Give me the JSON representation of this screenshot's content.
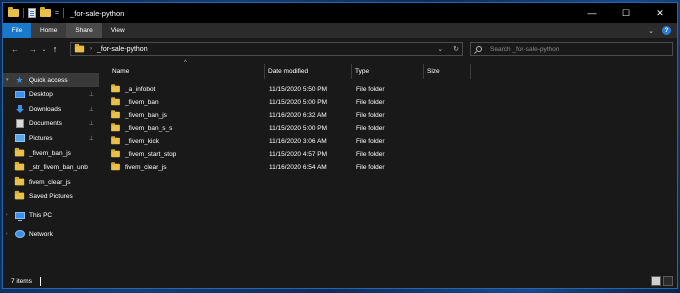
{
  "window": {
    "title": "_for-sale-python",
    "qat_arrow": "=",
    "controls": {
      "minimize": "—",
      "maximize": "☐",
      "close": "✕"
    }
  },
  "ribbon": {
    "tabs": [
      "File",
      "Home",
      "Share",
      "View"
    ],
    "expand_chevron": "⌄",
    "help": "?"
  },
  "nav": {
    "back": "←",
    "forward": "→",
    "recent": "⌄",
    "up": "↑",
    "address_chevron": "›",
    "address_path": "_for-sale-python",
    "address_dropdown": "⌄",
    "refresh": "↻",
    "search_placeholder": "Search _for-sale-python"
  },
  "sidebar": {
    "items": [
      {
        "label": "Quick access",
        "icon": "star-icon"
      },
      {
        "label": "Desktop",
        "icon": "desktop-icon",
        "pinned": true
      },
      {
        "label": "Downloads",
        "icon": "download-icon",
        "pinned": true
      },
      {
        "label": "Documents",
        "icon": "documents-icon",
        "pinned": true
      },
      {
        "label": "Pictures",
        "icon": "pictures-icon",
        "pinned": true
      },
      {
        "label": "_fivem_ban_js",
        "icon": "folder-icon"
      },
      {
        "label": "_str_fivem_ban_unb",
        "icon": "folder-icon"
      },
      {
        "label": "fivem_clear_js",
        "icon": "folder-icon"
      },
      {
        "label": "Saved Pictures",
        "icon": "folder-icon"
      },
      {
        "label": "This PC",
        "icon": "computer-icon"
      },
      {
        "label": "Network",
        "icon": "network-icon"
      }
    ],
    "pin_glyph": "📌"
  },
  "columns": {
    "name": "Name",
    "date": "Date modified",
    "type": "Type",
    "size": "Size",
    "sort_arrow": "^"
  },
  "files": [
    {
      "name": "_a_infobot",
      "date": "11/15/2020 5:50 PM",
      "type": "File folder"
    },
    {
      "name": "_fivem_ban",
      "date": "11/15/2020 5:00 PM",
      "type": "File folder"
    },
    {
      "name": "_fivem_ban_js",
      "date": "11/16/2020 6:32 AM",
      "type": "File folder"
    },
    {
      "name": "_fivem_ban_s_s",
      "date": "11/15/2020 5:00 PM",
      "type": "File folder"
    },
    {
      "name": "_fivem_kick",
      "date": "11/16/2020 3:06 AM",
      "type": "File folder"
    },
    {
      "name": "_fivem_start_stop",
      "date": "11/15/2020 4:57 PM",
      "type": "File folder"
    },
    {
      "name": "fivem_clear_js",
      "date": "11/16/2020 6:54 AM",
      "type": "File folder"
    }
  ],
  "status": {
    "item_count": "7 items"
  },
  "colors": {
    "accent": "#1979ca",
    "background": "#191919",
    "folder": "#e8c04a"
  }
}
